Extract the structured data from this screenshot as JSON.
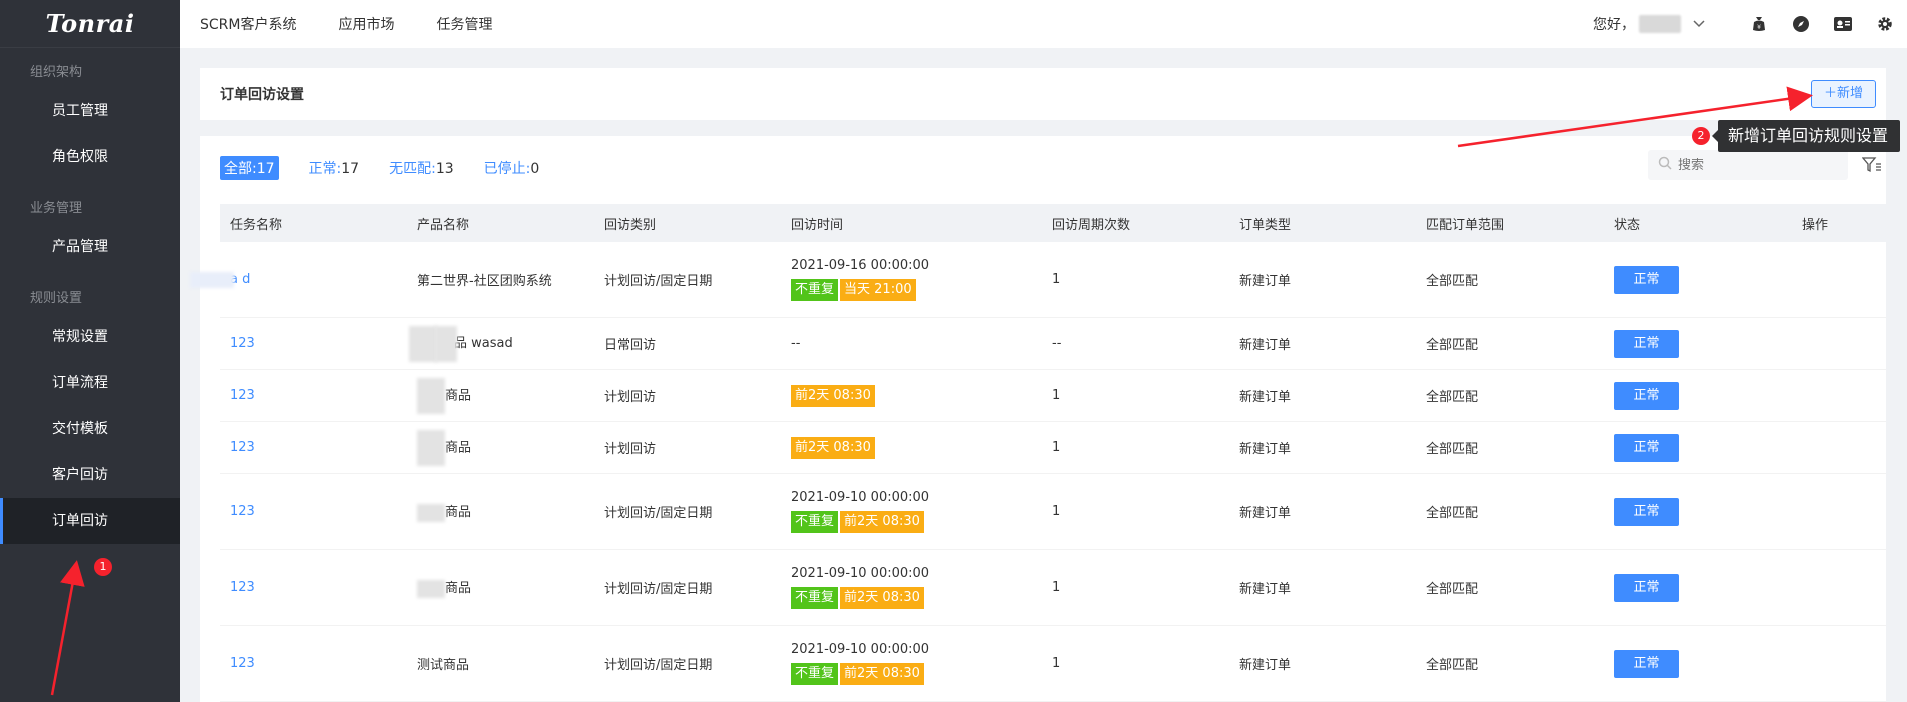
{
  "brand": {
    "logo": "Tonrai"
  },
  "sidebar": {
    "groups": [
      {
        "label": "组织架构",
        "items": [
          "员工管理",
          "角色权限"
        ]
      },
      {
        "label": "业务管理",
        "items": [
          "产品管理"
        ]
      },
      {
        "label": "规则设置",
        "items": [
          "常规设置",
          "订单流程",
          "交付模板",
          "客户回访",
          "订单回访"
        ]
      }
    ]
  },
  "topbar": {
    "menu": [
      "SCRM客户系统",
      "应用市场",
      "任务管理"
    ],
    "greeting": "您好，",
    "icons": [
      "bag-icon",
      "compass-icon",
      "id-card-icon",
      "gear-icon"
    ]
  },
  "page": {
    "title": "订单回访设置",
    "add_button": "＋新增"
  },
  "filters": [
    {
      "label": "全部:",
      "count": "17",
      "active": true
    },
    {
      "label": "正常:",
      "count": "17",
      "active": false
    },
    {
      "label": "无匹配:",
      "count": "13",
      "active": false
    },
    {
      "label": "已停止:",
      "count": "0",
      "active": false
    }
  ],
  "search": {
    "placeholder": "搜索"
  },
  "table": {
    "headers": [
      "任务名称",
      "产品名称",
      "回访类别",
      "回访时间",
      "回访周期次数",
      "订单类型",
      "匹配订单范围",
      "状态",
      "操作"
    ],
    "rows": [
      {
        "task": "a        d",
        "product": "第二世界-社区团购系统",
        "category": "计划回访/固定日期",
        "datetime": "2021-09-16 00:00:00",
        "tags": [
          "不重复",
          "当天 21:00"
        ],
        "times": "1",
        "order_type": "新建订单",
        "range": "全部匹配",
        "status": "正常"
      },
      {
        "task": "123",
        "product": "商品 wasad",
        "category": "日常回访",
        "datetime": "--",
        "tags": [],
        "times": "--",
        "order_type": "新建订单",
        "range": "全部匹配",
        "status": "正常"
      },
      {
        "task": "123",
        "product": "商品",
        "category": "计划回访",
        "datetime": "",
        "tags": [
          "前2天 08:30"
        ],
        "times": "1",
        "order_type": "新建订单",
        "range": "全部匹配",
        "status": "正常"
      },
      {
        "task": "123",
        "product": "商品",
        "category": "计划回访",
        "datetime": "",
        "tags": [
          "前2天 08:30"
        ],
        "times": "1",
        "order_type": "新建订单",
        "range": "全部匹配",
        "status": "正常"
      },
      {
        "task": "123",
        "product": "商品",
        "category": "计划回访/固定日期",
        "datetime": "2021-09-10 00:00:00",
        "tags": [
          "不重复",
          "前2天 08:30"
        ],
        "times": "1",
        "order_type": "新建订单",
        "range": "全部匹配",
        "status": "正常"
      },
      {
        "task": "123",
        "product": "商品",
        "category": "计划回访/固定日期",
        "datetime": "2021-09-10 00:00:00",
        "tags": [
          "不重复",
          "前2天 08:30"
        ],
        "times": "1",
        "order_type": "新建订单",
        "range": "全部匹配",
        "status": "正常"
      },
      {
        "task": "123",
        "product": "测试商品",
        "category": "计划回访/固定日期",
        "datetime": "2021-09-10 00:00:00",
        "tags": [
          "不重复",
          "前2天 08:30"
        ],
        "times": "1",
        "order_type": "新建订单",
        "range": "全部匹配",
        "status": "正常"
      }
    ]
  },
  "annotations": {
    "badge1": "1",
    "badge2": "2",
    "tooltip": "新增订单回访规则设置"
  },
  "colors": {
    "primary": "#3f8cff",
    "sidebar_bg": "#2f3239",
    "tag_green": "#52c41a",
    "tag_orange": "#faad14",
    "annotation_red": "#f5222d"
  }
}
